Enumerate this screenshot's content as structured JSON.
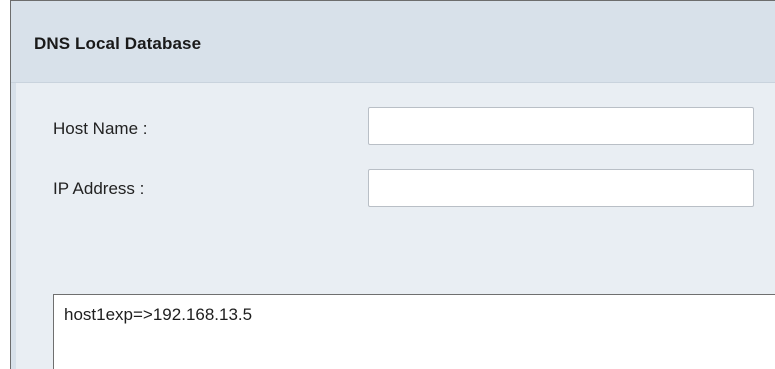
{
  "panel": {
    "title": "DNS Local Database"
  },
  "form": {
    "host_name_label": "Host Name :",
    "host_name_value": "",
    "ip_address_label": "IP Address :",
    "ip_address_value": ""
  },
  "database_list": {
    "entries": [
      "host1exp=>192.168.13.5"
    ]
  }
}
